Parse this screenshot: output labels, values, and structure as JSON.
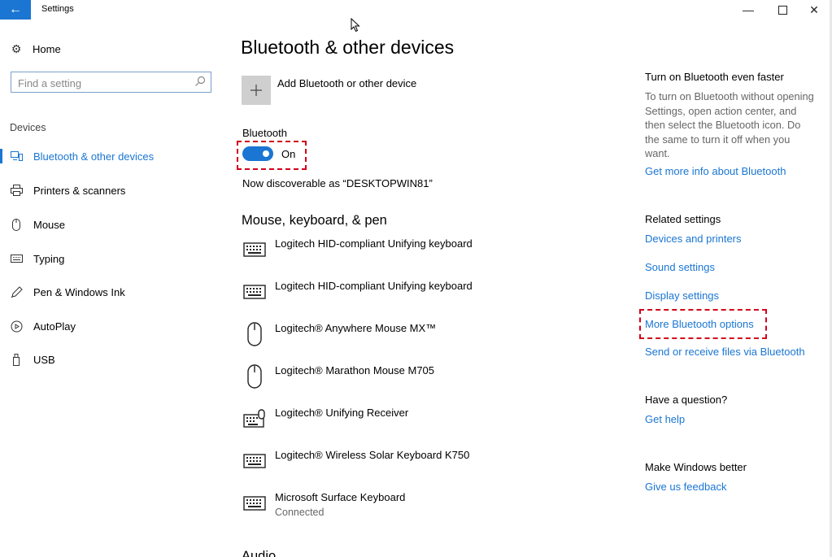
{
  "window": {
    "title": "Settings"
  },
  "nav": {
    "home_label": "Home",
    "search_placeholder": "Find a setting",
    "section_label": "Devices",
    "items": [
      {
        "label": "Bluetooth & other devices",
        "icon": "bluetooth-devices-icon",
        "active": true
      },
      {
        "label": "Printers & scanners",
        "icon": "printer-icon"
      },
      {
        "label": "Mouse",
        "icon": "mouse-icon"
      },
      {
        "label": "Typing",
        "icon": "keyboard-icon"
      },
      {
        "label": "Pen & Windows Ink",
        "icon": "pen-icon"
      },
      {
        "label": "AutoPlay",
        "icon": "autoplay-icon"
      },
      {
        "label": "USB",
        "icon": "usb-icon"
      }
    ]
  },
  "main": {
    "title": "Bluetooth & other devices",
    "add_device_label": "Add Bluetooth or other device",
    "bluetooth_label": "Bluetooth",
    "toggle_state": "On",
    "discoverable_text": "Now discoverable as “DESKTOPWIN81”",
    "section_title": "Mouse, keyboard, & pen",
    "devices": [
      {
        "name": "Logitech HID-compliant Unifying keyboard",
        "icon": "keyboard-icon"
      },
      {
        "name": "Logitech HID-compliant Unifying keyboard",
        "icon": "keyboard-icon"
      },
      {
        "name": "Logitech® Anywhere Mouse MX™",
        "icon": "mouse-icon"
      },
      {
        "name": "Logitech® Marathon Mouse M705",
        "icon": "mouse-icon"
      },
      {
        "name": "Logitech® Unifying Receiver",
        "icon": "keyboard-mouse-icon"
      },
      {
        "name": "Logitech® Wireless Solar Keyboard K750",
        "icon": "keyboard-icon"
      },
      {
        "name": "Microsoft Surface Keyboard",
        "status": "Connected",
        "icon": "keyboard-icon"
      }
    ],
    "next_section_partial": "Audio"
  },
  "right": {
    "tip_title": "Turn on Bluetooth even faster",
    "tip_body": "To turn on Bluetooth without opening Settings, open action center, and then select the Bluetooth icon. Do the same to turn it off when you want.",
    "tip_link": "Get more info about Bluetooth",
    "related_title": "Related settings",
    "related_links": [
      "Devices and printers",
      "Sound settings",
      "Display settings",
      "More Bluetooth options",
      "Send or receive files via Bluetooth"
    ],
    "question_title": "Have a question?",
    "question_link": "Get help",
    "better_title": "Make Windows better",
    "better_link": "Give us feedback"
  },
  "colors": {
    "accent": "#1a76d2",
    "highlight": "#d0021b"
  }
}
